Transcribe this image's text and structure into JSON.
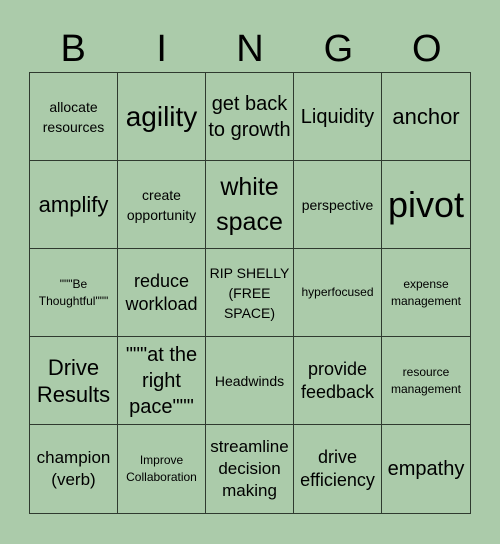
{
  "header": [
    "B",
    "I",
    "N",
    "G",
    "O"
  ],
  "cells": [
    {
      "text": "allocate resources",
      "size": "s14"
    },
    {
      "text": "agility",
      "size": "s28"
    },
    {
      "text": "get back to growth",
      "size": "s20"
    },
    {
      "text": "Liquidity",
      "size": "s20"
    },
    {
      "text": "anchor",
      "size": "s22"
    },
    {
      "text": "amplify",
      "size": "s22"
    },
    {
      "text": "create opportunity",
      "size": "s14"
    },
    {
      "text": "white space",
      "size": "s25"
    },
    {
      "text": "perspective",
      "size": "s14"
    },
    {
      "text": "pivot",
      "size": "s36"
    },
    {
      "text": "\"\"\"Be Thoughtful\"\"\"",
      "size": "s12"
    },
    {
      "text": "reduce workload",
      "size": "s18"
    },
    {
      "text": "RIP SHELLY (FREE SPACE)",
      "size": "s14"
    },
    {
      "text": "hyperfocused",
      "size": "s12"
    },
    {
      "text": "expense management",
      "size": "s12"
    },
    {
      "text": "Drive Results",
      "size": "s22"
    },
    {
      "text": "\"\"\"at the right pace\"\"\"",
      "size": "s20"
    },
    {
      "text": "Headwinds",
      "size": "s14"
    },
    {
      "text": "provide feedback",
      "size": "s18"
    },
    {
      "text": "resource management",
      "size": "s12"
    },
    {
      "text": "champion (verb)",
      "size": "s17"
    },
    {
      "text": "Improve Collaboration",
      "size": "s12"
    },
    {
      "text": "streamline decision making",
      "size": "s17"
    },
    {
      "text": "drive efficiency",
      "size": "s18"
    },
    {
      "text": "empathy",
      "size": "s20"
    }
  ]
}
